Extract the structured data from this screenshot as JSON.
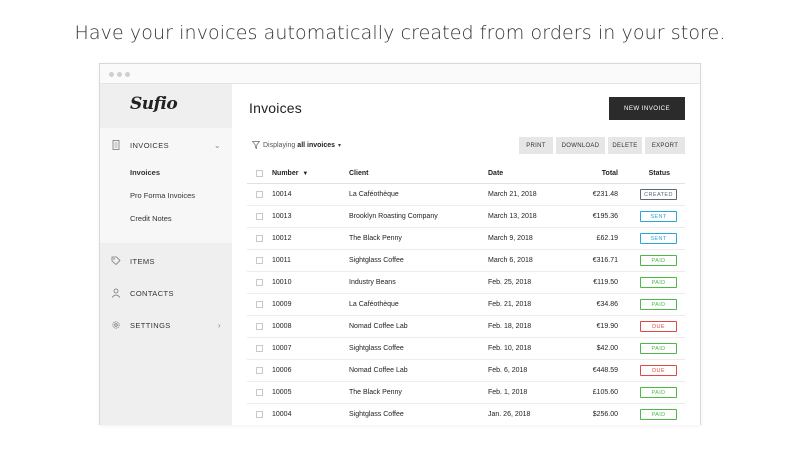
{
  "headline": "Have your invoices automatically created from orders in your store.",
  "app": {
    "logo": "Sufio"
  },
  "sidebar": {
    "invoices": {
      "label": "INVOICES",
      "icon": "document-icon"
    },
    "sub_items": [
      "Invoices",
      "Pro Forma Invoices",
      "Credit Notes"
    ],
    "items": {
      "label": "ITEMS",
      "icon": "tag-icon"
    },
    "contacts": {
      "label": "CONTACTS",
      "icon": "user-icon"
    },
    "settings": {
      "label": "SETTINGS",
      "icon": "gear-icon"
    }
  },
  "main": {
    "title": "Invoices",
    "new_button": "NEW INVOICE",
    "filter_prefix": "Displaying",
    "filter_value": "all invoices",
    "actions": [
      "PRINT",
      "DOWNLOAD",
      "DELETE",
      "EXPORT"
    ]
  },
  "table": {
    "headers": {
      "number": "Number",
      "client": "Client",
      "date": "Date",
      "total": "Total",
      "status": "Status"
    },
    "rows": [
      {
        "number": "10014",
        "client": "La Caféothèque",
        "date": "March 21, 2018",
        "total": "€231.48",
        "status": "CREATED"
      },
      {
        "number": "10013",
        "client": "Brooklyn Roasting Company",
        "date": "March 13, 2018",
        "total": "€195.36",
        "status": "SENT"
      },
      {
        "number": "10012",
        "client": "The Black Penny",
        "date": "March 9, 2018",
        "total": "£62.19",
        "status": "SENT"
      },
      {
        "number": "10011",
        "client": "Sightglass Coffee",
        "date": "March 6, 2018",
        "total": "€316.71",
        "status": "PAID"
      },
      {
        "number": "10010",
        "client": "Industry Beans",
        "date": "Feb. 25, 2018",
        "total": "€119.50",
        "status": "PAID"
      },
      {
        "number": "10009",
        "client": "La Caféothèque",
        "date": "Feb. 21, 2018",
        "total": "€34.86",
        "status": "PAID"
      },
      {
        "number": "10008",
        "client": "Nomad Coffee Lab",
        "date": "Feb. 18, 2018",
        "total": "€19.90",
        "status": "DUE"
      },
      {
        "number": "10007",
        "client": "Sightglass Coffee",
        "date": "Feb. 10, 2018",
        "total": "$42.00",
        "status": "PAID"
      },
      {
        "number": "10006",
        "client": "Nomad Coffee Lab",
        "date": "Feb. 6, 2018",
        "total": "€448.59",
        "status": "DUE"
      },
      {
        "number": "10005",
        "client": "The Black Penny",
        "date": "Feb. 1, 2018",
        "total": "£105.60",
        "status": "PAID"
      },
      {
        "number": "10004",
        "client": "Sightglass Coffee",
        "date": "Jan. 26, 2018",
        "total": "$256.00",
        "status": "PAID"
      }
    ]
  },
  "status_colors": {
    "CREATED": "#5a6a7a",
    "SENT": "#2aa6d8",
    "PAID": "#4cb848",
    "DUE": "#e04848"
  }
}
